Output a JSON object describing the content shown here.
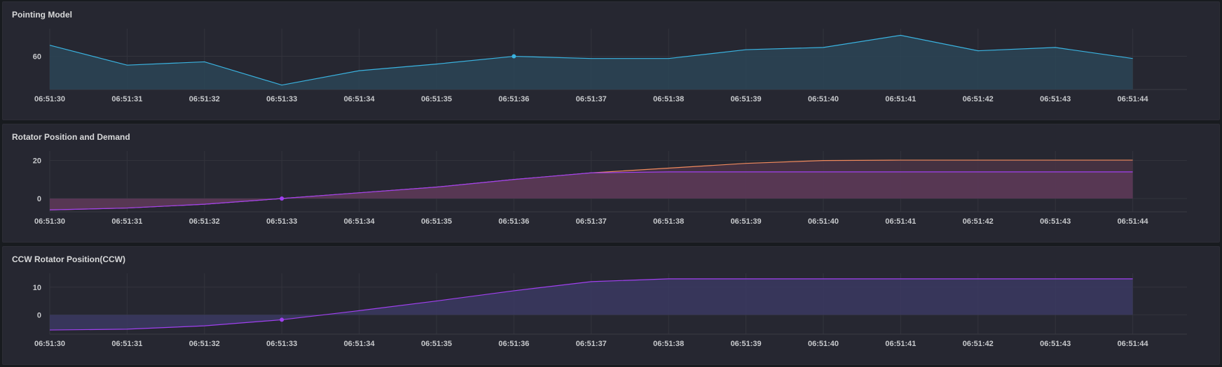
{
  "panels": [
    {
      "title": "Pointing Model"
    },
    {
      "title": "Rotator Position and Demand"
    },
    {
      "title": "CCW Rotator Position(CCW)"
    }
  ],
  "chart_data": [
    {
      "type": "area",
      "title": "Pointing Model",
      "categories": [
        "06:51:30",
        "06:51:31",
        "06:51:32",
        "06:51:33",
        "06:51:34",
        "06:51:35",
        "06:51:36",
        "06:51:37",
        "06:51:38",
        "06:51:39",
        "06:51:40",
        "06:51:41",
        "06:51:42",
        "06:51:43",
        "06:51:44"
      ],
      "yticks": [
        60
      ],
      "ylim": [
        30,
        85
      ],
      "grid": true,
      "series": [
        {
          "color": "#3ab3e0",
          "fill": "#2b4556",
          "values": [
            70,
            52,
            55,
            34,
            47,
            53,
            60,
            58,
            58,
            66,
            68,
            79,
            65,
            68,
            58
          ],
          "marker_index": 6
        }
      ]
    },
    {
      "type": "area",
      "title": "Rotator Position and Demand",
      "categories": [
        "06:51:30",
        "06:51:31",
        "06:51:32",
        "06:51:33",
        "06:51:34",
        "06:51:35",
        "06:51:36",
        "06:51:37",
        "06:51:38",
        "06:51:39",
        "06:51:40",
        "06:51:41",
        "06:51:42",
        "06:51:43",
        "06:51:44"
      ],
      "yticks": [
        0,
        20
      ],
      "ylim": [
        -7,
        25
      ],
      "grid": true,
      "series": [
        {
          "color": "#f08a5d",
          "fill": "#4a3444",
          "values": [
            -6,
            -5,
            -3,
            0,
            3,
            6,
            10,
            13.5,
            16,
            18.5,
            20,
            20.2,
            20.2,
            20.2,
            20.2
          ]
        },
        {
          "color": "#a040f0",
          "fill": "#5b3857",
          "values": [
            -6,
            -5,
            -3,
            0,
            3,
            6,
            10,
            13.5,
            14,
            14,
            14,
            14,
            14,
            14,
            14
          ],
          "marker_index": 3
        }
      ]
    },
    {
      "type": "area",
      "title": "CCW Rotator Position(CCW)",
      "categories": [
        "06:51:30",
        "06:51:31",
        "06:51:32",
        "06:51:33",
        "06:51:34",
        "06:51:35",
        "06:51:36",
        "06:51:37",
        "06:51:38",
        "06:51:39",
        "06:51:40",
        "06:51:41",
        "06:51:42",
        "06:51:43",
        "06:51:44"
      ],
      "yticks": [
        0,
        10
      ],
      "ylim": [
        -7,
        15
      ],
      "grid": true,
      "series": [
        {
          "color": "#a040f0",
          "fill": "#3b3a62",
          "values": [
            -5.5,
            -5.2,
            -4,
            -1.8,
            1.5,
            5,
            8.7,
            12,
            13,
            13,
            13,
            13,
            13,
            13,
            13
          ],
          "marker_index": 3
        }
      ]
    }
  ]
}
